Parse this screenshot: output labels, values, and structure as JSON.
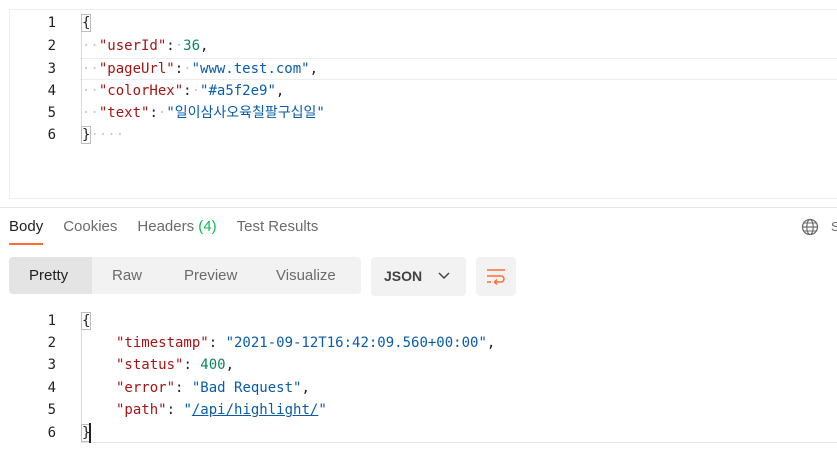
{
  "request": {
    "line_numbers": [
      "1",
      "2",
      "3",
      "4",
      "5",
      "6"
    ],
    "lines": [
      {
        "open": "{"
      },
      {
        "indent": "··",
        "key": "\"userId\"",
        "colon": ":",
        "sp": "·",
        "value": "36",
        "type": "num",
        "trail": ","
      },
      {
        "indent": "··",
        "key": "\"pageUrl\"",
        "colon": ":",
        "sp": "·",
        "value": "\"www.test.com\"",
        "type": "str",
        "trail": ","
      },
      {
        "indent": "··",
        "key": "\"colorHex\"",
        "colon": ":",
        "sp": "·",
        "value": "\"#a5f2e9\"",
        "type": "str",
        "trail": ","
      },
      {
        "indent": "··",
        "key": "\"text\"",
        "colon": ":",
        "sp": "·",
        "value": "\"일이삼사오육칠팔구십일\"",
        "type": "str",
        "trail": ""
      },
      {
        "close": "}",
        "ws": "····"
      }
    ]
  },
  "response_tabs": {
    "body": "Body",
    "cookies": "Cookies",
    "headers": "Headers",
    "headers_count": "(4)",
    "test_results": "Test Results"
  },
  "edge_text": "S",
  "format_toolbar": {
    "pretty": "Pretty",
    "raw": "Raw",
    "preview": "Preview",
    "visualize": "Visualize",
    "language": "JSON"
  },
  "response": {
    "line_numbers": [
      "1",
      "2",
      "3",
      "4",
      "5",
      "6"
    ],
    "open": "{",
    "close": "}",
    "fields": [
      {
        "key": "\"timestamp\"",
        "value": "\"2021-09-12T16:42:09.560+00:00\"",
        "type": "str",
        "trail": ","
      },
      {
        "key": "\"status\"",
        "value": "400",
        "type": "num",
        "trail": ","
      },
      {
        "key": "\"error\"",
        "value": "\"Bad Request\"",
        "type": "str",
        "trail": ","
      },
      {
        "key": "\"path\"",
        "value_q1": "\"",
        "value_link": "/api/highlight/",
        "value_q2": "\"",
        "type": "link",
        "trail": ""
      }
    ]
  },
  "colors": {
    "accent": "#ff6c37",
    "count_green": "#0cbb52",
    "key_color": "#a31515",
    "string_color": "#0a5ba8",
    "number_color": "#098658"
  }
}
